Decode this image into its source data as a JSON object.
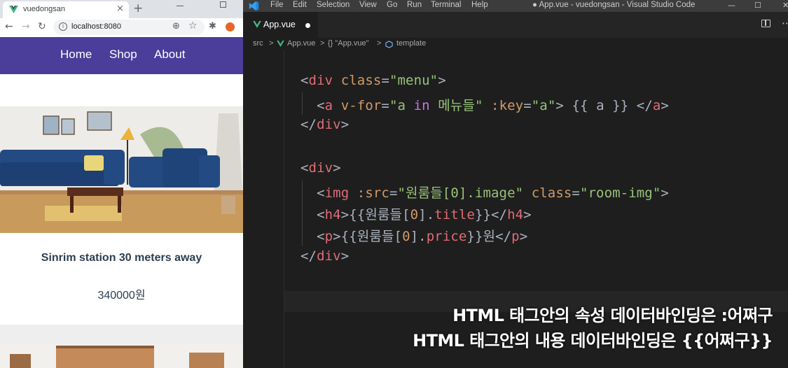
{
  "browser": {
    "tab_title": "vuedongsan",
    "tab_close": "×",
    "new_tab": "+",
    "url": "localhost:8080",
    "site_nav": [
      "Home",
      "Shop",
      "About"
    ],
    "room_title": "Sinrim station 30 meters away",
    "room_price": "340000원"
  },
  "vscode": {
    "menu": [
      "File",
      "Edit",
      "Selection",
      "View",
      "Go",
      "Run",
      "Terminal",
      "Help"
    ],
    "window_title": "● App.vue - vuedongsan - Visual Studio Code",
    "window_controls": [
      "—",
      "☐",
      "✕"
    ],
    "tab_label": "App.vue",
    "breadcrumb": [
      "src",
      ">",
      "App.vue",
      ">",
      "{} \"App.vue\"",
      ">",
      "template"
    ],
    "code": {
      "div_open_menu": [
        "<",
        "div",
        " ",
        "class",
        "=",
        "\"menu\"",
        ">"
      ],
      "a_line": [
        "<",
        "a",
        " ",
        "v-for",
        "=",
        "\"a ",
        "in",
        " 메뉴들\"",
        " ",
        ":key",
        "=",
        "\"a\"",
        ">",
        " {{ a }} ",
        "</",
        "a",
        ">"
      ],
      "div_close": [
        "</",
        "div",
        ">"
      ],
      "div_open": [
        "<",
        "div",
        ">"
      ],
      "img_line": [
        "<",
        "img",
        " ",
        ":src",
        "=",
        "\"원룸들[0].image\"",
        " ",
        "class",
        "=",
        "\"room-img\"",
        ">"
      ],
      "h4_line": [
        "<",
        "h4",
        ">",
        "{{원룸들[",
        "0",
        "].",
        "title",
        "}}",
        "</",
        "h4",
        ">"
      ],
      "p_line": [
        "<",
        "p",
        ">",
        "{{원룸들[",
        "0",
        "].",
        "price",
        "}}원",
        "</",
        "p",
        ">"
      ]
    },
    "subtitle_line1": "HTML 태그안의 속성 데이터바인딩은 :어쩌구",
    "subtitle_line2": "HTML 태그안의 내용 데이터바인딩은 {{어쩌구}}"
  },
  "colors": {
    "site_nav_bg": "#4b3d9a",
    "tag": "#e06c75",
    "attribute": "#d19a66",
    "string": "#98c379",
    "keyword": "#c678dd"
  }
}
